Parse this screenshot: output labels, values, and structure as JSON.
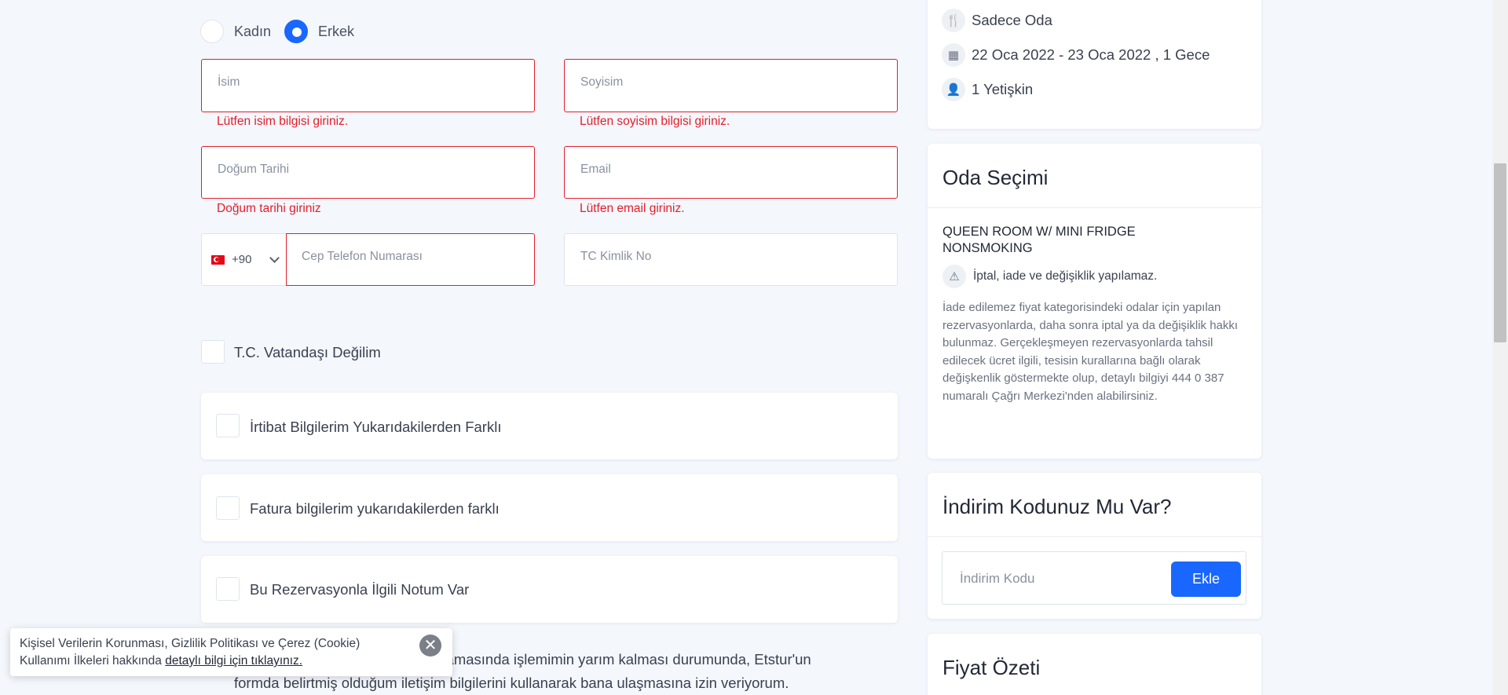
{
  "gender": {
    "female_label": "Kadın",
    "male_label": "Erkek",
    "selected": "Erkek"
  },
  "form": {
    "first_name": {
      "placeholder": "İsim",
      "error": "Lütfen isim bilgisi giriniz."
    },
    "last_name": {
      "placeholder": "Soyisim",
      "error": "Lütfen soyisim bilgisi giriniz."
    },
    "birth_date": {
      "placeholder": "Doğum Tarihi",
      "error": "Doğum tarihi giriniz"
    },
    "email": {
      "placeholder": "Email",
      "error": "Lütfen email giriniz."
    },
    "phone": {
      "country_code": "+90",
      "placeholder": "Cep Telefon Numarası"
    },
    "tc_id": {
      "placeholder": "TC Kimlik No"
    }
  },
  "options": {
    "not_citizen": "T.C. Vatandaşı Değilim",
    "contact_different": "İrtibat Bilgilerim Yukarıdakilerden Farklı",
    "billing_different": "Fatura bilgilerim yukarıdakilerden farklı",
    "has_note": "Bu Rezervasyonla İlgili Notum Var"
  },
  "consent": {
    "line1": "aşamasında işlemimin yarım kalması durumunda, Etstur'un",
    "line2": "formda belirtmiş olduğum iletişim bilgilerini kullanarak bana ulaşmasına izin veriyorum."
  },
  "summary": {
    "board": "Sadece Oda",
    "dates": "22 Oca 2022 - 23 Oca 2022 , 1 Gece",
    "guests": "1 Yetişkin"
  },
  "room_selection": {
    "title": "Oda Seçimi",
    "room_name": "QUEEN ROOM W/ MINI FRIDGE NONSMOKING",
    "warning": "İptal, iade ve değişiklik yapılamaz.",
    "policy": "İade edilemez fiyat kategorisindeki odalar için yapılan rezervasyonlarda, daha sonra iptal ya da değişiklik hakkı bulunmaz. Gerçekleşmeyen rezervasyonlarda tahsil edilecek ücret ilgili, tesisin kurallarına bağlı olarak değişkenlik göstermekte olup, detaylı bilgiyi 444 0 387 numaralı Çağrı Merkezi'nden alabilirsiniz."
  },
  "discount": {
    "title": "İndirim Kodunuz Mu Var?",
    "placeholder": "İndirim Kodu",
    "button": "Ekle"
  },
  "price_summary": {
    "title": "Fiyat Özeti"
  },
  "cookie": {
    "line1": "Kişisel Verilerin Korunması, Gizlilik Politikası ve Çerez (Cookie)",
    "line2_prefix": "Kullanımı İlkeleri hakkında",
    "link": "detaylı bilgi için tıklayınız."
  },
  "icons": {
    "board": "cutlery-icon",
    "dates": "calendar-icon",
    "guests": "person-icon",
    "warning": "warning-triangle-icon",
    "close": "close-icon",
    "flag": "turkey-flag-icon"
  },
  "colors": {
    "accent": "#1967ff",
    "error": "#e41e2b"
  }
}
